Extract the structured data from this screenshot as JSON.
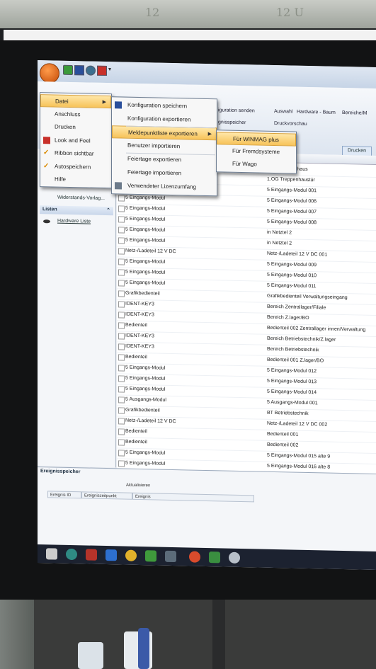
{
  "ribbon": {
    "texts": [
      "iguration senden",
      "Auswahl",
      "Hardware - Baum",
      "Bereiche/M",
      "gnisspeicher",
      "Druckvorschau"
    ],
    "drucken": "Drucken"
  },
  "menu_main": [
    {
      "label": "Datei",
      "highlight": true,
      "arrow": true
    },
    {
      "label": "Anschluss",
      "arrow": true
    },
    {
      "label": "Drucken",
      "arrow": true
    },
    {
      "label": "Look and Feel",
      "arrow": true,
      "icon": "paint-icon"
    },
    {
      "label": "Ribbon sichtbar",
      "check": true
    },
    {
      "label": "Autospeichern",
      "check": true
    },
    {
      "label": "Hilfe",
      "arrow": true
    }
  ],
  "menu_datei": [
    {
      "label": "Konfiguration speichern",
      "icon": "save-icon"
    },
    {
      "label": "Konfiguration exportieren"
    },
    {
      "label": "Meldepunktliste exportieren",
      "highlight": true,
      "arrow": true
    },
    {
      "label": "Benutzer importieren"
    },
    {
      "label": "Feiertage exportieren"
    },
    {
      "label": "Feiertage importieren"
    },
    {
      "label": "Verwendeter Lizenzumfang",
      "icon": "license-icon"
    }
  ],
  "menu_export": [
    {
      "label": "Für WINMAG plus",
      "highlight": true
    },
    {
      "label": "Für Fremdsysteme"
    },
    {
      "label": "Für Wago"
    }
  ],
  "leftpane": {
    "item": "Widerstands-Vorlag...",
    "section": "Listen",
    "list_item": "Hardware Liste"
  },
  "grid": {
    "header": "Name",
    "rows": [
      {
        "c1": "",
        "c2": "3.OG treppenhaus"
      },
      {
        "c1": "",
        "c2": "1.OG Treppenhaustür"
      },
      {
        "c1": "5 Eingangs-Modul",
        "c2": "5 Eingangs-Modul 001"
      },
      {
        "c1": "5 Eingangs-Modul",
        "c2": "5 Eingangs-Modul 006"
      },
      {
        "c1": "5 Eingangs-Modul",
        "c2": "5 Eingangs-Modul 007"
      },
      {
        "c1": "5 Eingangs-Modul",
        "c2": "5 Eingangs-Modul 008"
      },
      {
        "c1": "5 Eingangs-Modul",
        "c2": "in Netztel 2"
      },
      {
        "c1": "5 Eingangs-Modul",
        "c2": "in Netztel 2"
      },
      {
        "c1": "Netz-/Ladeteil 12 V DC",
        "c2": "Netz-/Ladeteil 12 V DC 001"
      },
      {
        "c1": "5 Eingangs-Modul",
        "c2": "5 Eingangs-Modul 009"
      },
      {
        "c1": "5 Eingangs-Modul",
        "c2": "5 Eingangs-Modul 010"
      },
      {
        "c1": "5 Eingangs-Modul",
        "c2": "5 Eingangs-Modul 011"
      },
      {
        "c1": "Grafikbedienteil",
        "c2": "Grafikbedienteil Verwaltungseingang"
      },
      {
        "c1": "IDENT-KEY3",
        "c2": "Bereich Zentrallager/Filiale"
      },
      {
        "c1": "IDENT-KEY3",
        "c2": "Bereich Z.lager/BO"
      },
      {
        "c1": "Bedienteil",
        "c2": "Bedienteil 002 Zentrallager innen/Verwaltung"
      },
      {
        "c1": "IDENT-KEY3",
        "c2": "Bereich Betriebstechnik/Z.lager"
      },
      {
        "c1": "IDENT-KEY3",
        "c2": "Bereich Betriebstechnik"
      },
      {
        "c1": "Bedienteil",
        "c2": "Bedienteil 001 Z.lager/BO"
      },
      {
        "c1": "5 Eingangs-Modul",
        "c2": "5 Eingangs-Modul 012"
      },
      {
        "c1": "5 Eingangs-Modul",
        "c2": "5 Eingangs-Modul 013"
      },
      {
        "c1": "5 Eingangs-Modul",
        "c2": "5 Eingangs-Modul 014"
      },
      {
        "c1": "5 Ausgangs-Modul",
        "c2": "5 Ausgangs-Modul 001"
      },
      {
        "c1": "Grafikbedienteil",
        "c2": "BT Betriebstechnik"
      },
      {
        "c1": "Netz-/Ladeteil 12 V DC",
        "c2": "Netz-/Ladeteil 12 V DC 002"
      },
      {
        "c1": "Bedienteil",
        "c2": "Bedienteil 001"
      },
      {
        "c1": "Bedienteil",
        "c2": "Bedienteil 002"
      },
      {
        "c1": "5 Eingangs-Modul",
        "c2": "5 Eingangs-Modul 015 alte 9"
      },
      {
        "c1": "5 Eingangs-Modul",
        "c2": "5 Eingangs-Modul 016 alte 8"
      }
    ]
  },
  "bottompane": {
    "title": "Ereignisspeicher",
    "refresh": "Aktualisieren",
    "columns": [
      "Ereignis ID",
      "Ereigniszeitpunkt",
      "Ereignis"
    ]
  },
  "desk_text": [
    "12",
    "12 U"
  ]
}
